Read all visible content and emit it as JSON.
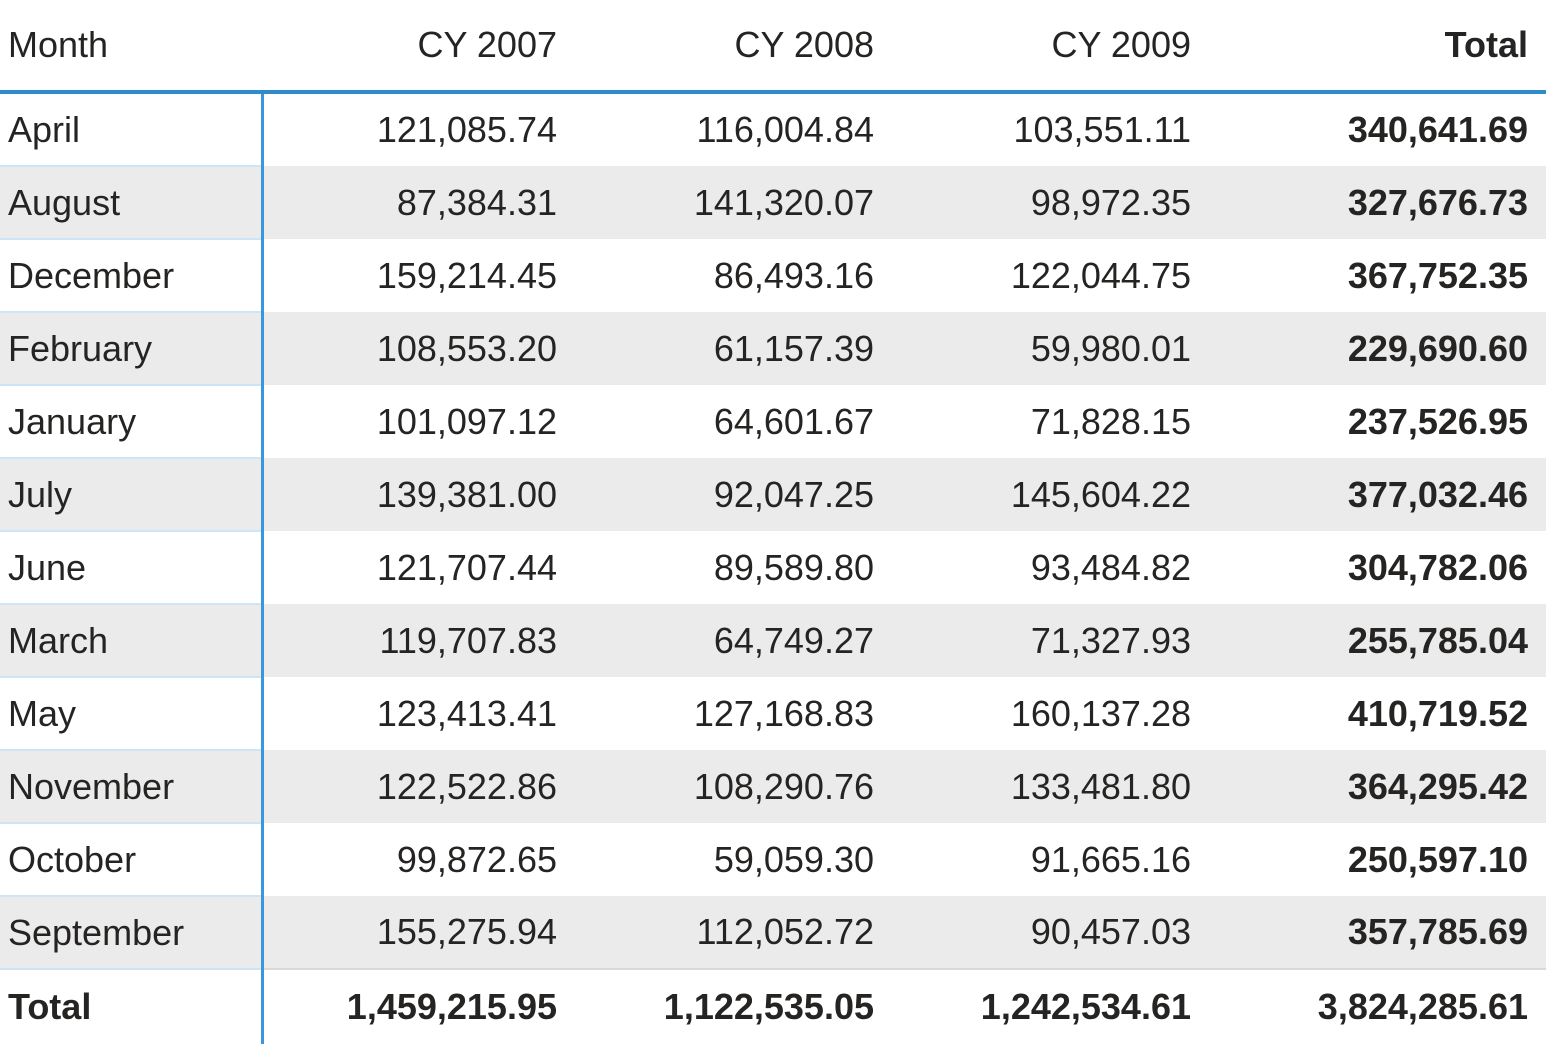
{
  "table": {
    "columns": [
      {
        "key": "month",
        "label": "Month",
        "align": "left",
        "bold": false
      },
      {
        "key": "cy2007",
        "label": "CY 2007",
        "align": "right",
        "bold": false
      },
      {
        "key": "cy2008",
        "label": "CY 2008",
        "align": "right",
        "bold": false
      },
      {
        "key": "cy2009",
        "label": "CY 2009",
        "align": "right",
        "bold": false
      },
      {
        "key": "total",
        "label": "Total",
        "align": "right",
        "bold": true
      }
    ],
    "rows": [
      {
        "month": "April",
        "cy2007": "121,085.74",
        "cy2008": "116,004.84",
        "cy2009": "103,551.11",
        "total": "340,641.69"
      },
      {
        "month": "August",
        "cy2007": "87,384.31",
        "cy2008": "141,320.07",
        "cy2009": "98,972.35",
        "total": "327,676.73"
      },
      {
        "month": "December",
        "cy2007": "159,214.45",
        "cy2008": "86,493.16",
        "cy2009": "122,044.75",
        "total": "367,752.35"
      },
      {
        "month": "February",
        "cy2007": "108,553.20",
        "cy2008": "61,157.39",
        "cy2009": "59,980.01",
        "total": "229,690.60"
      },
      {
        "month": "January",
        "cy2007": "101,097.12",
        "cy2008": "64,601.67",
        "cy2009": "71,828.15",
        "total": "237,526.95"
      },
      {
        "month": "July",
        "cy2007": "139,381.00",
        "cy2008": "92,047.25",
        "cy2009": "145,604.22",
        "total": "377,032.46"
      },
      {
        "month": "June",
        "cy2007": "121,707.44",
        "cy2008": "89,589.80",
        "cy2009": "93,484.82",
        "total": "304,782.06"
      },
      {
        "month": "March",
        "cy2007": "119,707.83",
        "cy2008": "64,749.27",
        "cy2009": "71,327.93",
        "total": "255,785.04"
      },
      {
        "month": "May",
        "cy2007": "123,413.41",
        "cy2008": "127,168.83",
        "cy2009": "160,137.28",
        "total": "410,719.52"
      },
      {
        "month": "November",
        "cy2007": "122,522.86",
        "cy2008": "108,290.76",
        "cy2009": "133,481.80",
        "total": "364,295.42"
      },
      {
        "month": "October",
        "cy2007": "99,872.65",
        "cy2008": "59,059.30",
        "cy2009": "91,665.16",
        "total": "250,597.10"
      },
      {
        "month": "September",
        "cy2007": "155,275.94",
        "cy2008": "112,052.72",
        "cy2009": "90,457.03",
        "total": "357,785.69"
      }
    ],
    "grand_total": {
      "month": "Total",
      "cy2007": "1,459,215.95",
      "cy2008": "1,122,535.05",
      "cy2009": "1,242,534.61",
      "total": "3,824,285.61"
    }
  },
  "chart_data": {
    "type": "table",
    "title": "",
    "categories": [
      "April",
      "August",
      "December",
      "February",
      "January",
      "July",
      "June",
      "March",
      "May",
      "November",
      "October",
      "September"
    ],
    "series": [
      {
        "name": "CY 2007",
        "values": [
          121085.74,
          87384.31,
          159214.45,
          108553.2,
          101097.12,
          139381.0,
          121707.44,
          119707.83,
          123413.41,
          122522.86,
          99872.65,
          155275.94
        ],
        "total": 1459215.95
      },
      {
        "name": "CY 2008",
        "values": [
          116004.84,
          141320.07,
          86493.16,
          61157.39,
          64601.67,
          92047.25,
          89589.8,
          64749.27,
          127168.83,
          108290.76,
          59059.3,
          112052.72
        ],
        "total": 1122535.05
      },
      {
        "name": "CY 2009",
        "values": [
          103551.11,
          98972.35,
          122044.75,
          59980.01,
          71828.15,
          145604.22,
          93484.82,
          71327.93,
          160137.28,
          133481.8,
          91665.16,
          90457.03
        ],
        "total": 1242534.61
      }
    ],
    "row_totals": [
      340641.69,
      327676.73,
      367752.35,
      229690.6,
      237526.95,
      377032.46,
      304782.06,
      255785.04,
      410719.52,
      364295.42,
      250597.1,
      357785.69
    ],
    "grand_total": 3824285.61,
    "xlabel": "Month",
    "ylabel": ""
  },
  "colors": {
    "header_rule": "#2f8ccc",
    "column_divider": "#3a96dd",
    "row_rule": "#cfe4f5",
    "band": "#ebebeb",
    "text": "#252423",
    "background": "#ffffff"
  }
}
